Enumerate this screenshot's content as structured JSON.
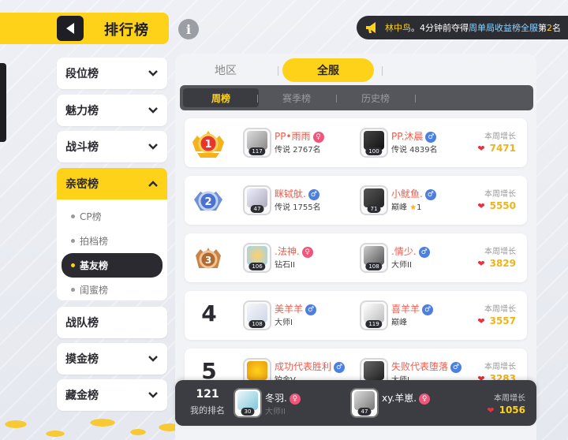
{
  "header": {
    "title": "排行榜"
  },
  "notice": {
    "user": "林中鸟",
    "text_a": "。4分钟前夺得",
    "highlight": "周单局收益榜全服",
    "text_b": "第",
    "rank": "2",
    "text_c": "名"
  },
  "sidebar": {
    "items": [
      {
        "label": "段位榜"
      },
      {
        "label": "魅力榜"
      },
      {
        "label": "战斗榜"
      },
      {
        "label": "亲密榜"
      },
      {
        "label": "战队榜"
      },
      {
        "label": "摸金榜"
      },
      {
        "label": "藏金榜"
      }
    ],
    "sub_items": [
      {
        "label": "CP榜"
      },
      {
        "label": "拍档榜"
      },
      {
        "label": "基友榜"
      },
      {
        "label": "闺蜜榜"
      }
    ]
  },
  "region_tabs": [
    {
      "label": "地区"
    },
    {
      "label": "全服"
    }
  ],
  "period_tabs": [
    {
      "label": "周榜"
    },
    {
      "label": "赛季榜"
    },
    {
      "label": "历史榜"
    }
  ],
  "gain_label": "本周增长",
  "rows": [
    {
      "rank": "1",
      "p1": {
        "name": "PP•雨雨",
        "tier": "传说 2767名",
        "level": "117",
        "gender": "♀"
      },
      "p2": {
        "name": "PP.沐晨",
        "tier": "传说 4839名",
        "level": "100",
        "gender": "♂"
      },
      "gain": "7471"
    },
    {
      "rank": "2",
      "p1": {
        "name": "眯铽舦.",
        "tier": "传说 1755名",
        "level": "47",
        "gender": "♂"
      },
      "p2": {
        "name": "小鱿鱼.",
        "tier": "巅峰",
        "tier_star": "1",
        "level": "71",
        "gender": "♂"
      },
      "gain": "5550"
    },
    {
      "rank": "3",
      "p1": {
        "name": ".法神.",
        "tier": "钻石II",
        "level": "106",
        "gender": "♀"
      },
      "p2": {
        "name": ".情少.",
        "tier": "大师II",
        "level": "108",
        "gender": "♂"
      },
      "gain": "3829"
    },
    {
      "rank": "4",
      "p1": {
        "name": "美羊羊",
        "tier": "大师I",
        "level": "108",
        "gender": "♂"
      },
      "p2": {
        "name": "喜羊羊",
        "tier": "巅峰",
        "level": "119",
        "gender": "♂"
      },
      "gain": "3557"
    },
    {
      "rank": "5",
      "p1": {
        "name": "成功代表胜利",
        "tier": "铂金V",
        "level": "",
        "gender": "♂"
      },
      "p2": {
        "name": "失败代表堕落",
        "tier": "大师I",
        "level": "",
        "gender": "♂"
      },
      "gain": "3283"
    }
  ],
  "my_rank": {
    "rank": "121",
    "label": "我的排名",
    "p1": {
      "name": "冬羽.",
      "tier": "大师II",
      "level": "30",
      "gender": "♀"
    },
    "p2": {
      "name": "xy.羊崽.",
      "tier": "",
      "level": "47",
      "gender": "♀"
    },
    "gain": "1056"
  },
  "colors": {
    "accent": "#ffd21a",
    "dark": "#2a2a30",
    "name_red": "#f05b4c",
    "gain_gold": "#f0b419"
  }
}
